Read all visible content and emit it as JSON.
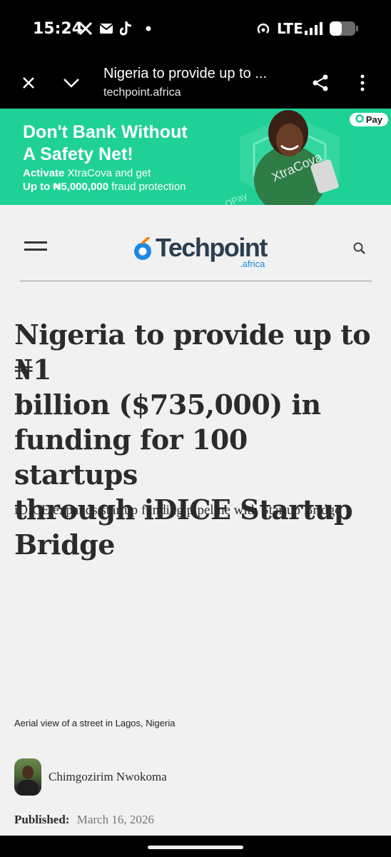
{
  "status_bar": {
    "time": "15:24",
    "network": "LTE",
    "icons": [
      "x-icon",
      "mail-icon",
      "tiktok-icon",
      "dot-icon",
      "hotspot-icon",
      "signal-icon",
      "battery-icon"
    ]
  },
  "browser": {
    "title": "Nigeria to provide up to ...",
    "url": "techpoint.africa",
    "icons": [
      "close-icon",
      "chevron-down-icon",
      "share-icon",
      "more-vert-icon"
    ]
  },
  "ad": {
    "headline_line1": "Don't Bank Without",
    "headline_line2": "A Safety Net!",
    "line1_bold": "Activate",
    "line1_rest": " XtraCova and get",
    "line2_bold": "Up to ₦5,000,000",
    "line2_rest": " fraud protection",
    "badge": "Pay",
    "art_text": "XtraCova",
    "art_text_small": "OPay",
    "colors": {
      "background": "#1fd196",
      "text": "#ffffff"
    }
  },
  "site": {
    "logo_text": "Techpoint",
    "logo_sub": ".africa",
    "icons": [
      "menu-icon",
      "search-icon"
    ],
    "colors": {
      "logo_accent": "#1e88e5",
      "logo_text": "#2c3e50"
    }
  },
  "article": {
    "headline_lines": [
      "Nigeria to provide up to ₦1",
      "billion ($735,000) in",
      "funding for 100 startups",
      "through iDICE Startup",
      "Bridge"
    ],
    "subheadline": "iDICE expands startup funding pipeline with Startup Bridge",
    "image_caption": "Aerial view of a street in Lagos, Nigeria",
    "author": "Chimgozirim Nwokoma",
    "published_label": "Published:",
    "published_date": "March 16, 2026"
  }
}
